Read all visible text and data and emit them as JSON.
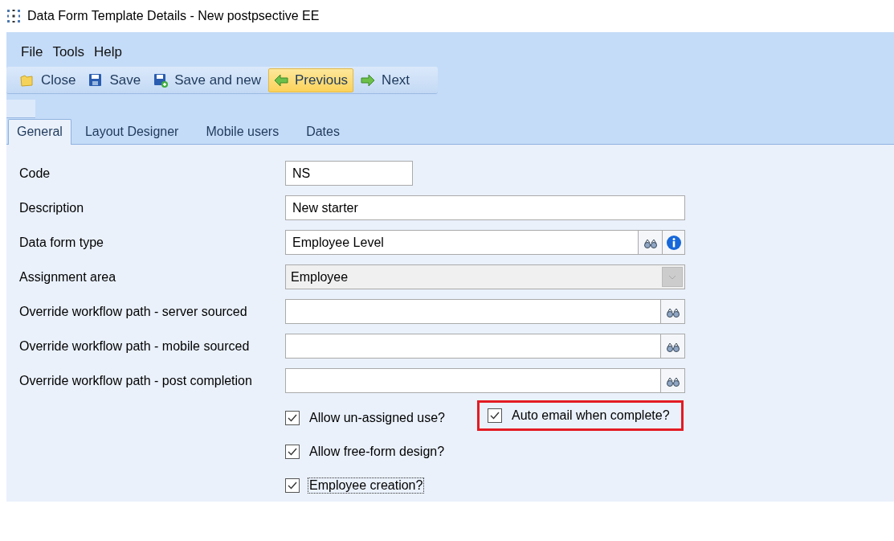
{
  "window": {
    "title": "Data Form Template Details - New postpsective EE"
  },
  "menu": [
    "File",
    "Tools",
    "Help"
  ],
  "toolbar": [
    {
      "kind": "folder",
      "label": "Close",
      "highlighted": false
    },
    {
      "kind": "save",
      "label": "Save",
      "highlighted": false
    },
    {
      "kind": "save-new",
      "label": "Save and new",
      "highlighted": false
    },
    {
      "kind": "back",
      "label": "Previous",
      "highlighted": true
    },
    {
      "kind": "forward",
      "label": "Next",
      "highlighted": false
    }
  ],
  "tabs": [
    {
      "label": "General",
      "selected": true
    },
    {
      "label": "Layout Designer",
      "selected": false
    },
    {
      "label": "Mobile users",
      "selected": false
    },
    {
      "label": "Dates",
      "selected": false
    }
  ],
  "fields": [
    {
      "label": "Code",
      "kind": "short",
      "value": "NS"
    },
    {
      "label": "Description",
      "kind": "text",
      "value": "New starter"
    },
    {
      "label": "Data form type",
      "kind": "lookup-info",
      "value": "Employee Level"
    },
    {
      "label": "Assignment area",
      "kind": "combo",
      "value": "Employee",
      "disabled": true
    },
    {
      "label": "Override workflow path - server sourced",
      "kind": "lookup"
    },
    {
      "label": "Override workflow path - mobile sourced",
      "kind": "lookup"
    },
    {
      "label": "Override workflow path - post completion",
      "kind": "lookup"
    }
  ],
  "checkboxes": [
    [
      {
        "label": "Allow un-assigned use?",
        "checked": true,
        "focused": false,
        "highlighted": false
      },
      {
        "label": "Auto email when complete?",
        "checked": true,
        "focused": false,
        "highlighted": true
      }
    ],
    [
      {
        "label": "Allow free-form design?",
        "checked": true,
        "focused": false,
        "highlighted": false
      }
    ],
    [
      {
        "label": "Employee creation?",
        "checked": true,
        "focused": true,
        "highlighted": false
      }
    ]
  ]
}
